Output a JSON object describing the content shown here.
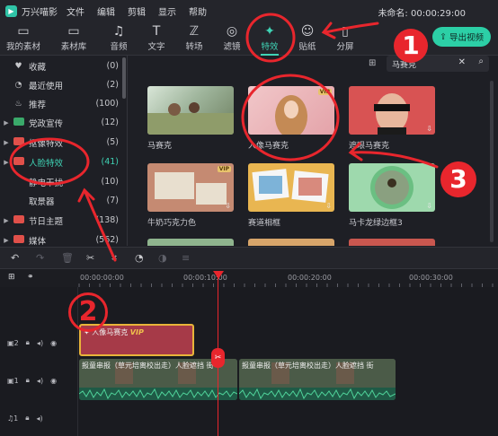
{
  "app": {
    "name": "万兴喵影",
    "project": "未命名: 00:00:29:00"
  },
  "menus": [
    "文件",
    "编辑",
    "剪辑",
    "显示",
    "帮助"
  ],
  "toolbar": {
    "items": [
      {
        "label": "我的素材",
        "icon": "folder-icon"
      },
      {
        "label": "素材库",
        "icon": "folder-cloud-icon"
      },
      {
        "label": "音频",
        "icon": "music-note-icon"
      },
      {
        "label": "文字",
        "icon": "text-icon"
      },
      {
        "label": "转场",
        "icon": "transition-icon"
      },
      {
        "label": "滤镜",
        "icon": "filter-icon"
      },
      {
        "label": "特效",
        "icon": "magic-wand-icon",
        "active": true
      },
      {
        "label": "贴纸",
        "icon": "sticker-icon"
      },
      {
        "label": "分屏",
        "icon": "split-screen-icon"
      }
    ],
    "export_label": "导出视频"
  },
  "sidebar": {
    "items": [
      {
        "label": "收藏",
        "count": "(0)",
        "icon": "heart-icon"
      },
      {
        "label": "最近使用",
        "count": "(2)",
        "icon": "clock-icon"
      },
      {
        "label": "推荐",
        "count": "(100)",
        "icon": "flame-icon"
      },
      {
        "label": "党政宣传",
        "count": "(12)",
        "tag": "党政"
      },
      {
        "label": "抠像特效",
        "count": "(5)",
        "tag": "抠"
      },
      {
        "label": "人脸特效",
        "count": "(41)",
        "tag": "脸",
        "active": true
      },
      {
        "label": "静电干扰",
        "count": "(10)"
      },
      {
        "label": "取景器",
        "count": "(7)"
      },
      {
        "label": "节日主题",
        "count": "(138)",
        "tag": "节"
      },
      {
        "label": "媒体",
        "count": "(562)",
        "tag": "媒"
      }
    ]
  },
  "search": {
    "value": "马赛克"
  },
  "effects": [
    {
      "title": "马赛克",
      "vip": false,
      "download": false
    },
    {
      "title": "人像马赛克",
      "vip": true,
      "download": false
    },
    {
      "title": "遮眼马赛克",
      "vip": false,
      "download": true
    },
    {
      "title": "牛奶巧克力色",
      "vip": true,
      "download": true
    },
    {
      "title": "赛道相框",
      "vip": false,
      "download": true
    },
    {
      "title": "马卡龙绿边框3",
      "vip": false,
      "download": true
    }
  ],
  "vip_label": "VIP",
  "timeline": {
    "ticks": [
      "00:00:00:00",
      "00:00:10:00",
      "00:00:20:00",
      "00:00:30:00"
    ],
    "tracks": [
      {
        "name": "2",
        "type": "video"
      },
      {
        "name": "1",
        "type": "video"
      },
      {
        "name": "1",
        "type": "audio"
      }
    ],
    "effect_clip": {
      "label": "人像马赛克",
      "vip": "VIP"
    },
    "video_clips": [
      {
        "label": "报童串报（草元培离校出走）人脸遮挡 街"
      },
      {
        "label": "报童串报（草元培离校出走）人脸遮挡 街"
      }
    ]
  },
  "annotations": [
    "1",
    "2",
    "3"
  ],
  "colors": {
    "accent": "#3fd3b5",
    "annotation": "#e8262d",
    "effect_clip": "#a63a48",
    "export": "#2ccfa6"
  }
}
